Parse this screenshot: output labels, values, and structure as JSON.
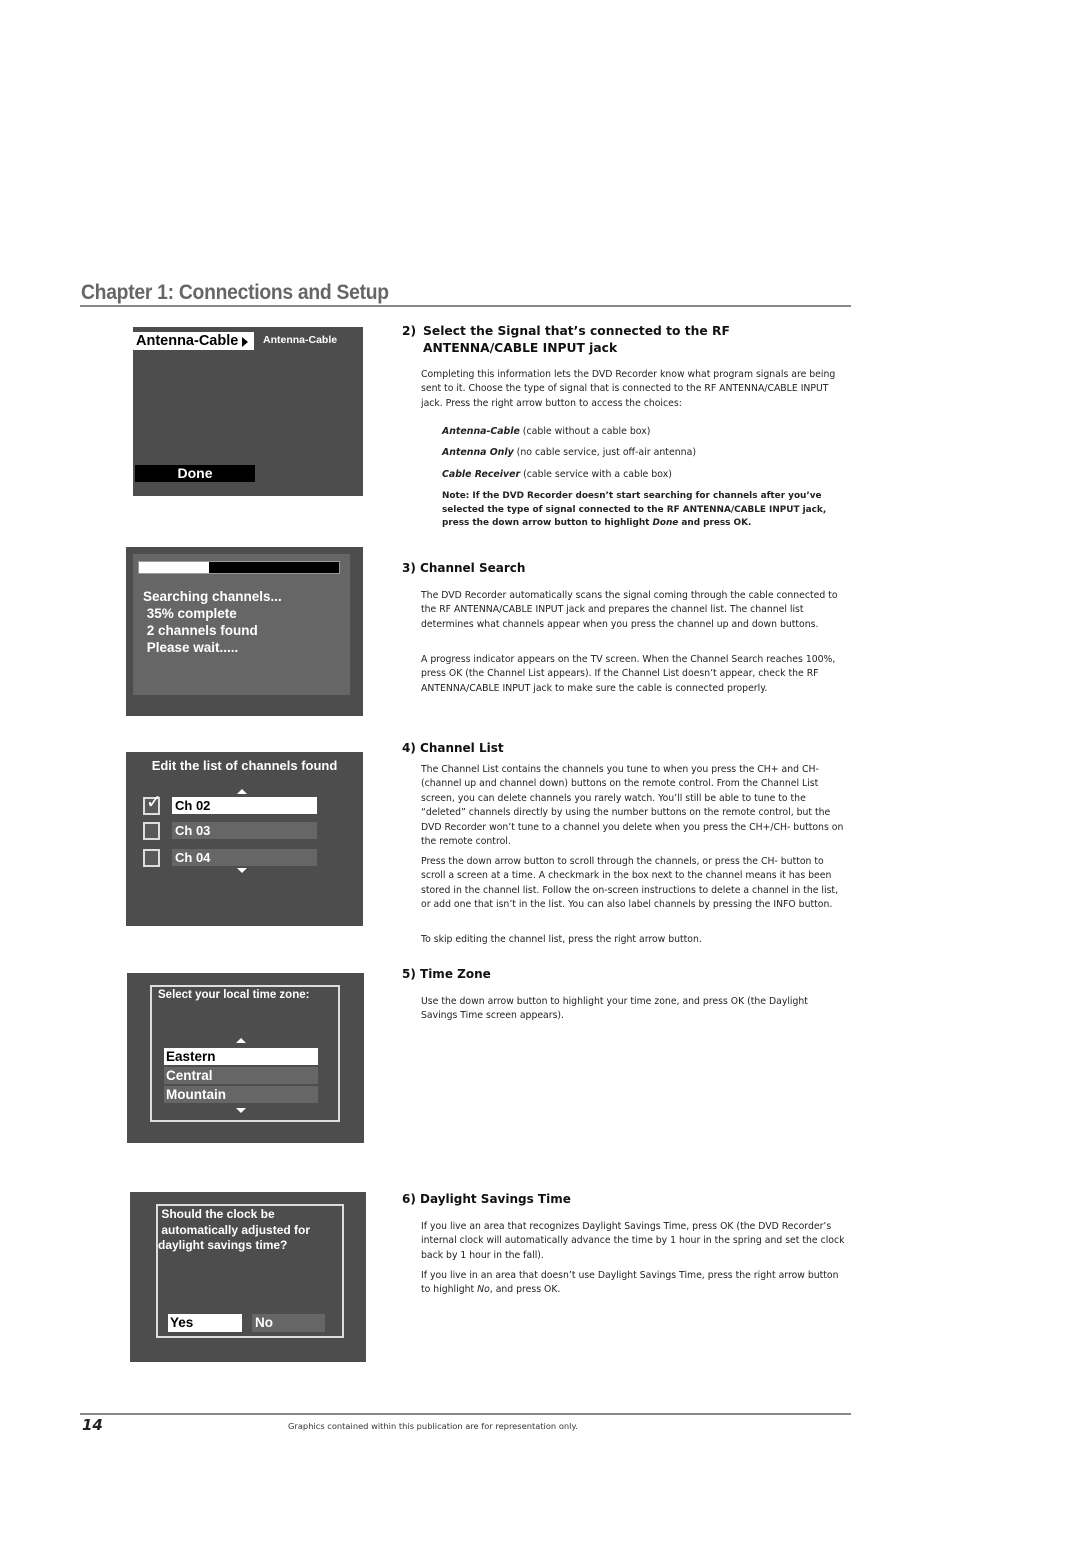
{
  "chapter": {
    "title": "Chapter 1: Connections and Setup"
  },
  "screens": {
    "signal": {
      "selected_label": "Antenna-Cable",
      "current_value": "Antenna-Cable",
      "done_label": "Done"
    },
    "search": {
      "progress_percent": 35,
      "lines": [
        "Searching channels...",
        " 35% complete",
        " 2 channels found",
        " Please wait....."
      ]
    },
    "channel_list": {
      "title": "Edit the list of channels found",
      "channels": [
        {
          "label": "Ch 02",
          "checked": true,
          "highlighted": true
        },
        {
          "label": "Ch 03",
          "checked": false,
          "highlighted": false
        },
        {
          "label": "Ch 04",
          "checked": false,
          "highlighted": false
        }
      ]
    },
    "time_zone": {
      "title": "Select your local time zone:",
      "options": [
        {
          "label": "Eastern",
          "highlighted": true
        },
        {
          "label": "Central",
          "highlighted": false
        },
        {
          "label": "Mountain",
          "highlighted": false
        }
      ]
    },
    "dst": {
      "question": " Should the clock be\n automatically adjusted for\ndaylight savings time?",
      "yes_label": "Yes",
      "no_label": "No"
    }
  },
  "sections": {
    "s2": {
      "number": "2)",
      "title_line1": "Select the Signal that’s connected to the RF",
      "title_line2": "ANTENNA/CABLE INPUT jack",
      "body": "Completing this information lets the DVD Recorder know what program signals are being sent to it. Choose the type of signal that is connected to the RF ANTENNA/CABLE INPUT jack. Press the right arrow button to access the choices:",
      "choices": [
        {
          "name": "Antenna-Cable",
          "desc": " (cable without a cable box)"
        },
        {
          "name": "Antenna Only",
          "desc": " (no cable service, just off-air antenna)"
        },
        {
          "name": "Cable Receiver",
          "desc": " (cable service with a cable box)"
        }
      ],
      "note_pre": "Note: If the DVD Recorder doesn’t start searching for channels after you’ve selected the type of signal connected to the RF ANTENNA/CABLE INPUT jack, press the down arrow button to highlight ",
      "note_em": "Done",
      "note_post": " and press OK."
    },
    "s3": {
      "title": "3) Channel Search",
      "p1": "The DVD Recorder automatically scans the signal coming through the cable connected to the RF ANTENNA/CABLE INPUT jack and prepares the channel list. The channel list determines what channels appear when you press the channel up and down buttons.",
      "p2": "A progress indicator appears on the TV screen. When the Channel Search reaches 100%, press OK (the Channel List appears). If the Channel List doesn’t appear, check the RF ANTENNA/CABLE INPUT jack to make sure the cable is connected properly."
    },
    "s4": {
      "title": "4) Channel List",
      "p1": "The Channel List contains the channels you tune to when you press the CH+ and CH- (channel up and channel down) buttons on the remote control. From the Channel List screen, you can delete channels you rarely watch. You’ll still be able to tune to the “deleted” channels directly by using the number buttons on the remote control, but the DVD Recorder won’t tune to a channel you delete when you press the CH+/CH- buttons on the remote control.",
      "p2": "Press the down arrow button to scroll through the channels, or press the CH- button to scroll a screen at a time. A checkmark in the box next to the channel means it has been stored in the channel list. Follow the on-screen instructions to delete a channel in the list, or add one that isn’t in the list. You can also label channels by pressing the INFO button.",
      "p3": "To skip editing the channel list, press the right arrow button."
    },
    "s5": {
      "title": "5) Time Zone",
      "p1": "Use the down arrow button to highlight your time zone, and press OK (the Daylight Savings Time screen appears)."
    },
    "s6": {
      "title": "6) Daylight Savings Time",
      "p1": "If you live an area that recognizes Daylight Savings Time, press OK (the DVD Recorder’s internal clock will automatically advance the time by 1 hour in the spring and set the clock back by 1 hour in the fall).",
      "p2_pre": "If you live in an area that doesn’t use Daylight Savings Time, press the right arrow button to highlight ",
      "p2_em": "No",
      "p2_post": ", and press OK."
    }
  },
  "footer": {
    "page_number": "14",
    "disclaimer": "Graphics contained within this publication are for representation only."
  }
}
